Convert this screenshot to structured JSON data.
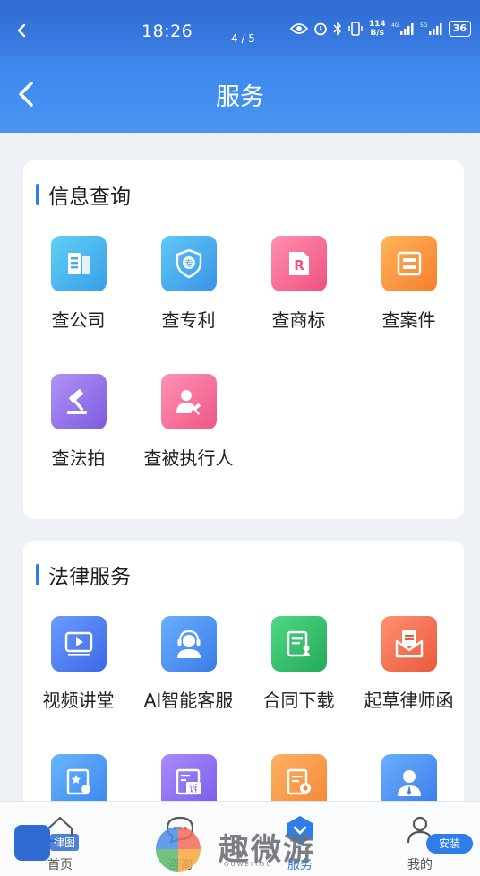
{
  "status_bar": {
    "time": "18:26",
    "page_indicator": "4 / 5",
    "net_speed_value": "114",
    "net_speed_unit": "B/s",
    "signal_1_label": "4G",
    "signal_2_label": "5G",
    "battery": "36"
  },
  "header": {
    "title": "服务"
  },
  "info_query": {
    "title": "信息查询",
    "items": [
      {
        "label": "查公司",
        "icon": "building-icon",
        "color": "#4ab3ef"
      },
      {
        "label": "查专利",
        "icon": "patent-shield-icon",
        "color": "#4aa8ea"
      },
      {
        "label": "查商标",
        "icon": "trademark-icon",
        "color": "#f36a8f"
      },
      {
        "label": "查案件",
        "icon": "case-file-icon",
        "color": "#f7963e"
      },
      {
        "label": "查法拍",
        "icon": "gavel-icon",
        "color": "#9a7bea"
      },
      {
        "label": "查被执行人",
        "icon": "person-gavel-icon",
        "color": "#f4729a"
      }
    ]
  },
  "legal_services": {
    "title": "法律服务",
    "items": [
      {
        "label": "视频讲堂",
        "icon": "video-play-icon",
        "color": "#4d7df0"
      },
      {
        "label": "AI智能客服",
        "icon": "headset-agent-icon",
        "color": "#4a8ff0"
      },
      {
        "label": "合同下载",
        "icon": "contract-download-icon",
        "color": "#34bf6d"
      },
      {
        "label": "起草律师函",
        "icon": "lawyer-letter-icon",
        "color": "#f0744f"
      },
      {
        "label": "",
        "icon": "certificate-icon",
        "color": "#4a9ef0"
      },
      {
        "label": "",
        "icon": "complaint-doc-icon",
        "color": "#8f6ff0"
      },
      {
        "label": "",
        "icon": "stamp-doc-icon",
        "color": "#f5934a"
      },
      {
        "label": "",
        "icon": "lawyer-person-icon",
        "color": "#4a8ff0"
      }
    ],
    "partial_texts": {
      "complaint_icon_char": "诉"
    }
  },
  "bottom_nav": {
    "items": [
      {
        "label": "首页",
        "icon": "home-icon",
        "active": false
      },
      {
        "label": "咨询",
        "icon": "chat-icon",
        "active": false
      },
      {
        "label": "服务",
        "icon": "service-hexagon-icon",
        "active": true
      },
      {
        "label": "我的",
        "icon": "user-icon",
        "active": false
      }
    ]
  },
  "overlays": {
    "watermark_text": "趣微游",
    "watermark_sub": "QUWEIYOU",
    "install_label": "安装",
    "app_badge_label": "律图"
  }
}
